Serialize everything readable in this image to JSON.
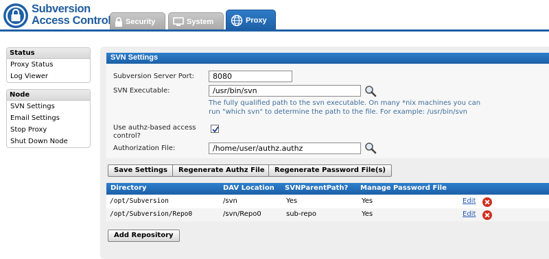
{
  "app": {
    "brand_line1": "Subversion",
    "brand_line2": "Access Control"
  },
  "tabs": [
    {
      "label": "Security",
      "icon": "lock-icon"
    },
    {
      "label": "System",
      "icon": "monitor-icon"
    },
    {
      "label": "Proxy",
      "icon": "globe-icon",
      "active": true
    }
  ],
  "sidebar": {
    "status": {
      "title": "Status",
      "items": [
        "Proxy Status",
        "Log Viewer"
      ]
    },
    "node": {
      "title": "Node",
      "items": [
        "SVN Settings",
        "Email Settings",
        "Stop Proxy",
        "Shut Down Node"
      ]
    }
  },
  "settings": {
    "title": "SVN Settings",
    "port_label": "Subversion Server Port:",
    "port_value": "8080",
    "exe_label": "SVN Executable:",
    "exe_value": "/usr/bin/svn",
    "exe_hint": "The fully qualified path to the svn executable. On many *nix machines you can run \"which svn\" to determine the path to the file. For example: /usr/bin/svn",
    "authz_label_1": "Use authz-based access",
    "authz_label_2": "control?",
    "authz_checked": true,
    "auth_file_label": "Authorization File:",
    "auth_file_value": "/home/user/authz.authz"
  },
  "buttons": {
    "save": "Save Settings",
    "regen_authz": "Regenerate Authz File",
    "regen_password": "Regenerate Password File(s)",
    "add_repo": "Add Repository"
  },
  "table": {
    "headers": [
      "Directory",
      "DAV Location",
      "SVNParentPath?",
      "Manage Password File"
    ],
    "rows": [
      {
        "directory": "/opt/Subversion",
        "dav": "/svn",
        "parent": "Yes",
        "manage": "Yes",
        "edit": "Edit"
      },
      {
        "directory": "/opt/Subversion/Repo0",
        "dav": "/svn/Repo0",
        "parent": "sub-repo",
        "manage": "Yes",
        "edit": "Edit"
      }
    ]
  },
  "colors": {
    "accent": "#1d5fa6",
    "hint_text": "#3d6e9d",
    "delete": "#cf2f1f"
  }
}
